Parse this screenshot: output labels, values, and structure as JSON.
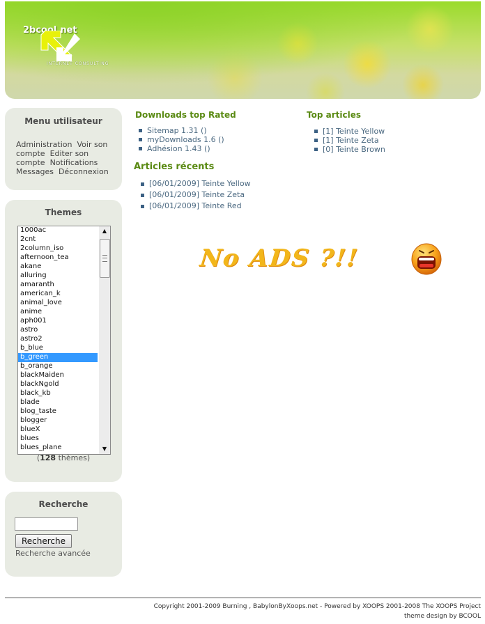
{
  "header": {
    "logo_text": "2bcool.net",
    "logo_sub": "INTERNET CONSULTING"
  },
  "menu": {
    "title": "Menu utilisateur",
    "links": [
      "Administration",
      "Voir son compte",
      "Editer son compte",
      "Notifications",
      "Messages",
      "Déconnexion"
    ]
  },
  "themes": {
    "title": "Themes",
    "items": [
      "1000ac",
      "2cnt",
      "2column_iso",
      "afternoon_tea",
      "akane",
      "alluring",
      "amaranth",
      "american_k",
      "animal_love",
      "anime",
      "aph001",
      "astro",
      "astro2",
      "b_blue",
      "b_green",
      "b_orange",
      "blackMaiden",
      "blackNgold",
      "black_kb",
      "blade",
      "blog_taste",
      "blogger",
      "blueX",
      "blues",
      "blues_plane"
    ],
    "selected": "b_green",
    "count": "128",
    "count_label": "thèmes"
  },
  "search": {
    "title": "Recherche",
    "input_value": "",
    "button_label": "Recherche",
    "advanced_link": "Recherche avancée"
  },
  "downloads": {
    "title": "Downloads top Rated",
    "items": [
      "Sitemap 1.31 ()",
      "myDownloads 1.6 ()",
      "Adhésion 1.43 ()"
    ]
  },
  "top_articles": {
    "title": "Top articles",
    "items": [
      "[1] Teinte Yellow",
      "[1] Teinte Zeta",
      "[0] Teinte Brown"
    ]
  },
  "recent_articles": {
    "title": "Articles récents",
    "items": [
      "[06/01/2009] Teinte Yellow",
      "[06/01/2009] Teinte Zeta",
      "[06/01/2009] Teinte Red"
    ]
  },
  "ad": {
    "text": "No ADS ?!!"
  },
  "footer": {
    "line1": "Copyright 2001-2009 Burning , BabylonByXoops.net - Powered by XOOPS 2001-2008 The XOOPS Project",
    "line2": "theme design by BCOOL"
  },
  "colors": {
    "accent": "#5a8a13",
    "link": "#4a6880",
    "box_bg": "#e8ebe3",
    "selection": "#3399ff"
  }
}
